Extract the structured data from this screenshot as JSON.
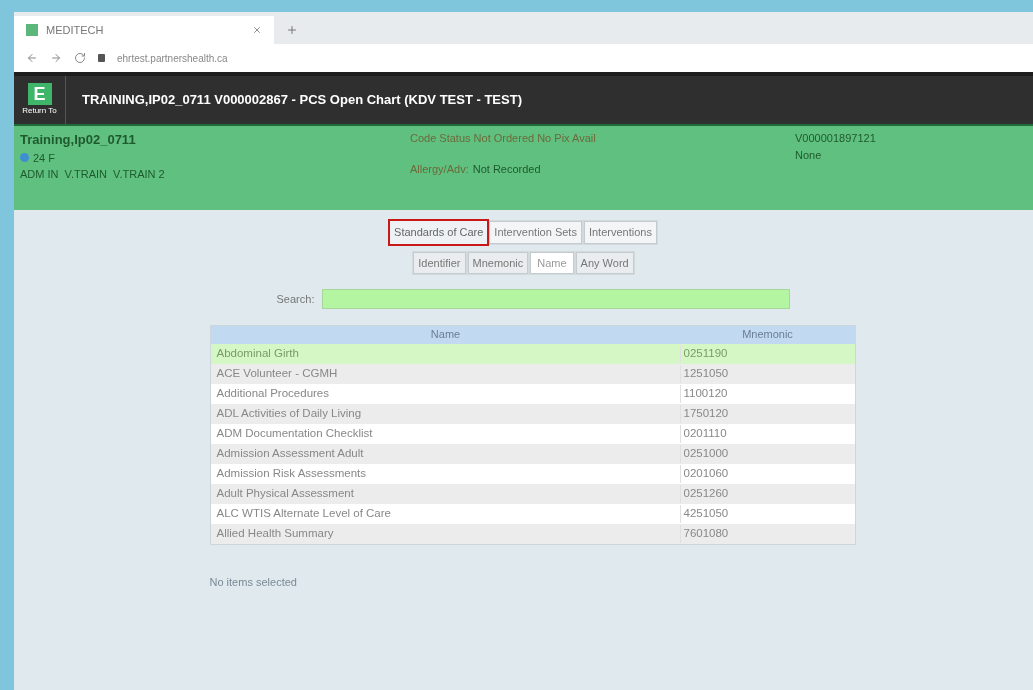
{
  "browser": {
    "tab_title": "MEDITECH",
    "url": "ehrtest.partnershealth.ca"
  },
  "app_bar": {
    "logo": "E",
    "return_label": "Return To",
    "title": "TRAINING,IP02_0711 V000002867 - PCS Open Chart (KDV TEST - TEST)"
  },
  "patient": {
    "name": "Training,Ip02_0711",
    "age_sex": "24 F",
    "location": "ADM IN  V.TRAIN  V.TRAIN 2",
    "code_status": "Code Status Not Ordered No Pix Avail",
    "allergy_label": "Allergy/Adv:",
    "allergy_value": "Not Recorded",
    "account": "V000001897121",
    "account_note": "None"
  },
  "category_tabs": [
    {
      "label": "Standards of Care",
      "selected": true
    },
    {
      "label": "Intervention Sets",
      "selected": false
    },
    {
      "label": "Interventions",
      "selected": false
    }
  ],
  "search_by_tabs": [
    {
      "label": "Identifier",
      "selected": false
    },
    {
      "label": "Mnemonic",
      "selected": false
    },
    {
      "label": "Name",
      "selected": true
    },
    {
      "label": "Any Word",
      "selected": false
    }
  ],
  "search": {
    "label": "Search:"
  },
  "table": {
    "columns": [
      "Name",
      "Mnemonic"
    ],
    "rows": [
      {
        "name": "Abdominal Girth",
        "mnemonic": "0251190",
        "selected": true
      },
      {
        "name": "ACE Volunteer - CGMH",
        "mnemonic": "1251050",
        "selected": false
      },
      {
        "name": "Additional Procedures",
        "mnemonic": "1100120",
        "selected": false
      },
      {
        "name": "ADL Activities of Daily Living",
        "mnemonic": "1750120",
        "selected": false
      },
      {
        "name": "ADM Documentation Checklist",
        "mnemonic": "0201110",
        "selected": false
      },
      {
        "name": "Admission Assessment Adult",
        "mnemonic": "0251000",
        "selected": false
      },
      {
        "name": "Admission Risk Assessments",
        "mnemonic": "0201060",
        "selected": false
      },
      {
        "name": "Adult Physical Assessment",
        "mnemonic": "0251260",
        "selected": false
      },
      {
        "name": "ALC WTIS Alternate Level of Care",
        "mnemonic": "4251050",
        "selected": false
      },
      {
        "name": "Allied Health Summary",
        "mnemonic": "7601080",
        "selected": false
      }
    ]
  },
  "status": "No items selected"
}
